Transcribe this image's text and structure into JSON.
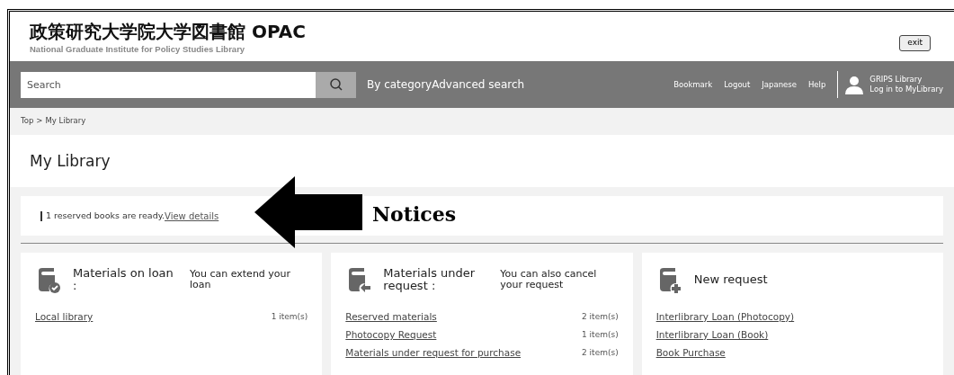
{
  "header": {
    "title": "政策研究大学院大学図書館 OPAC",
    "subtitle": "National Graduate Institute for Policy Studies Library",
    "exit_button": "exit"
  },
  "nav": {
    "search": {
      "placeholder": "Search"
    },
    "links": [
      "By category",
      "Advanced search"
    ],
    "right_links": [
      "Bookmark",
      "Logout",
      "Japanese",
      "Help"
    ],
    "user": {
      "name": "GRIPS Library",
      "action": "Log in to MyLibrary"
    }
  },
  "breadcrumb": [
    "Top",
    ">",
    "My Library"
  ],
  "page_title": "My Library",
  "notice": {
    "text": "1 reserved books are ready.",
    "link": "View details"
  },
  "annotation": {
    "label": "Notices"
  },
  "cards": [
    {
      "title": "Materials on loan :",
      "subtitle": "You can extend your loan",
      "rows": [
        {
          "label": "Local library",
          "count": "1 item(s)"
        }
      ]
    },
    {
      "title": "Materials under request :",
      "subtitle": "You can also cancel your request",
      "rows": [
        {
          "label": "Reserved materials",
          "count": "2 item(s)"
        },
        {
          "label": "Photocopy Request",
          "count": "1 item(s)"
        },
        {
          "label": "Materials under request for purchase",
          "count": "2 item(s)"
        }
      ]
    },
    {
      "title": "New request",
      "rows": [
        {
          "label": "Interlibrary Loan (Photocopy)"
        },
        {
          "label": "Interlibrary Loan (Book)"
        },
        {
          "label": "Book Purchase"
        }
      ]
    }
  ]
}
